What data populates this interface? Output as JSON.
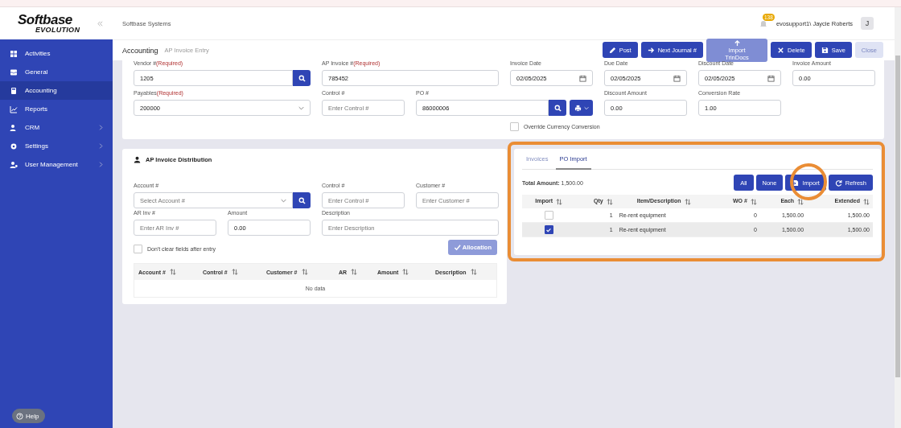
{
  "sidebar": {
    "logo_top": "Softbase",
    "logo_bottom": "EVOLUTION",
    "items": [
      {
        "label": "Activities",
        "selected": false,
        "has_children": false
      },
      {
        "label": "General",
        "selected": false,
        "has_children": false
      },
      {
        "label": "Accounting",
        "selected": true,
        "has_children": false
      },
      {
        "label": "Reports",
        "selected": false,
        "has_children": false
      },
      {
        "label": "CRM",
        "selected": false,
        "has_children": true
      },
      {
        "label": "Settings",
        "selected": false,
        "has_children": true
      },
      {
        "label": "User Management",
        "selected": false,
        "has_children": true
      }
    ],
    "help": "Help"
  },
  "topbar": {
    "company": "Softbase Systems",
    "notification_count": "138",
    "user": "evosupport1\\ Jaycie Roberts",
    "avatar": "J"
  },
  "page_header": {
    "title": "Accounting",
    "subtitle": "AP Invoice Entry",
    "buttons": [
      {
        "label": "Post",
        "kind": "primary"
      },
      {
        "label": "Next Journal #",
        "kind": "primary"
      },
      {
        "label": "Import TrinDocs",
        "kind": "muted"
      },
      {
        "label": "Delete",
        "kind": "primary"
      },
      {
        "label": "Save",
        "kind": "primary"
      },
      {
        "label": "Close",
        "kind": "light"
      }
    ]
  },
  "invoice_form": {
    "fields": [
      {
        "label": "Vendor #",
        "required": "(Required)",
        "kind": "search",
        "value": "1205"
      },
      {
        "label": "AP Invoice #",
        "required": "(Required)",
        "kind": "text",
        "value": "785452"
      },
      {
        "label": "Invoice Date",
        "kind": "date",
        "value": "02/05/2025"
      },
      {
        "label": "Due Date",
        "kind": "date",
        "value": "02/05/2025"
      },
      {
        "label": "Discount Date",
        "kind": "date",
        "value": "02/05/2025"
      },
      {
        "label": "Invoice Amount",
        "kind": "text",
        "value": "0.00"
      },
      {
        "label": "Payables",
        "required": "(Required)",
        "kind": "select",
        "value": "200000"
      },
      {
        "label": "Control #",
        "kind": "text",
        "placeholder": "Enter Control #"
      },
      {
        "label": "PO #",
        "kind": "po",
        "value": "86000006"
      },
      {
        "label": "Discount Amount",
        "kind": "text",
        "value": "0.00"
      },
      {
        "label": "Conversion Rate",
        "kind": "text",
        "value": "1.00"
      }
    ],
    "override": {
      "label": "Override Currency Conversion",
      "checked": false
    }
  },
  "distribution": {
    "title": "AP Invoice Distribution",
    "fields": [
      {
        "label": "Account #",
        "kind": "select-search",
        "placeholder": "Select Account #"
      },
      {
        "label": "Control #",
        "kind": "text",
        "placeholder": "Enter Control #"
      },
      {
        "label": "Customer #",
        "kind": "text",
        "placeholder": "Enter Customer #"
      },
      {
        "label": "AR Inv #",
        "kind": "text",
        "placeholder": "Enter AR Inv #"
      },
      {
        "label": "Amount",
        "kind": "text",
        "value": "0.00"
      },
      {
        "label": "Description",
        "kind": "wide",
        "placeholder": "Enter Description"
      }
    ],
    "keep_fields": {
      "label": "Don't clear fields after entry",
      "checked": false
    },
    "allocation_button": "Allocation",
    "table": {
      "columns": [
        "Account #",
        "Control #",
        "Customer #",
        "AR",
        "Amount",
        "Description"
      ],
      "empty": "No data"
    }
  },
  "po_panel": {
    "tabs": [
      {
        "label": "Invoices",
        "selected": false
      },
      {
        "label": "PO Import",
        "selected": true
      }
    ],
    "total_label": "Total Amount:",
    "total_value": "1,500.00",
    "buttons": [
      "All",
      "None",
      "Import",
      "Refresh"
    ],
    "table": {
      "columns": [
        "Import",
        "Qty",
        "Item/Description",
        "WO #",
        "Each",
        "Extended"
      ],
      "rows": [
        {
          "checked": false,
          "qty": "1",
          "description": "Re-rent equipment",
          "wo": "0",
          "each": "1,500.00",
          "extended": "1,500.00"
        },
        {
          "checked": true,
          "qty": "1",
          "description": "Re-rent equipment",
          "wo": "0",
          "each": "1,500.00",
          "extended": "1,500.00"
        }
      ]
    }
  }
}
